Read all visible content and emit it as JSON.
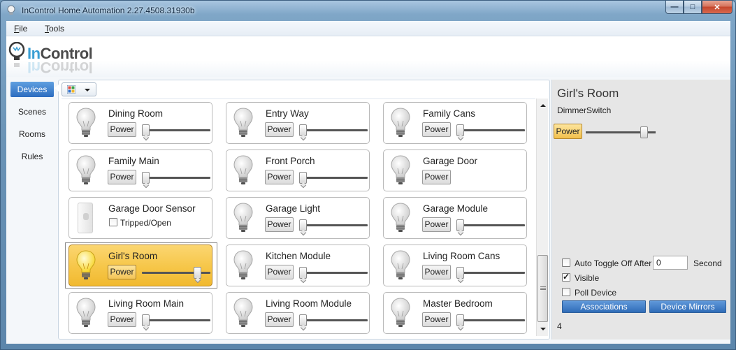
{
  "window": {
    "title": "InControl Home Automation 2.27.4508.31930b",
    "minimize": "—",
    "maximize": "□",
    "close": "✕"
  },
  "menu": {
    "file": "File",
    "tools": "Tools"
  },
  "logo": {
    "text_in": "In",
    "text_control": "Control"
  },
  "sidebar": {
    "items": [
      {
        "label": "Devices",
        "active": true
      },
      {
        "label": "Scenes"
      },
      {
        "label": "Rooms"
      },
      {
        "label": "Rules"
      }
    ]
  },
  "devices": [
    {
      "name": "Dining Room",
      "power": "Power",
      "level": 0
    },
    {
      "name": "Entry Way",
      "power": "Power",
      "level": 0
    },
    {
      "name": "Family Cans",
      "power": "Power",
      "level": 0
    },
    {
      "name": "Family Main",
      "power": "Power",
      "level": 0
    },
    {
      "name": "Front Porch",
      "power": "Power",
      "level": 0
    },
    {
      "name": "Garage Door",
      "power": "Power"
    },
    {
      "name": "Garage Door Sensor",
      "check_label": "Tripped/Open",
      "checked": false
    },
    {
      "name": "Garage Light",
      "power": "Power",
      "level": 0
    },
    {
      "name": "Garage Module",
      "power": "Power",
      "level": 0
    },
    {
      "name": "Girl's Room",
      "power": "Power",
      "level": 0.85,
      "on": true
    },
    {
      "name": "Kitchen Module",
      "power": "Power",
      "level": 0
    },
    {
      "name": "Living Room Cans",
      "power": "Power",
      "level": 0
    },
    {
      "name": "Living Room Main",
      "power": "Power",
      "level": 0
    },
    {
      "name": "Living Room Module",
      "power": "Power",
      "level": 0
    },
    {
      "name": "Master Bedroom",
      "power": "Power",
      "level": 0
    }
  ],
  "details": {
    "title": "Girl's Room",
    "type": "DimmerSwitch",
    "power": "Power",
    "level": 0.85,
    "auto_toggle_label": "Auto Toggle Off After",
    "auto_toggle_checked": false,
    "auto_toggle_value": "0",
    "auto_toggle_unit": "Second",
    "visible_label": "Visible",
    "visible_checked": true,
    "poll_label": "Poll Device",
    "poll_checked": false,
    "associations_label": "Associations",
    "mirrors_label": "Device Mirrors",
    "count": "4"
  },
  "colors": {
    "accent": "#2d6dc0",
    "selected_tile": "#f6c648",
    "button_blue": "#3a77c2"
  }
}
